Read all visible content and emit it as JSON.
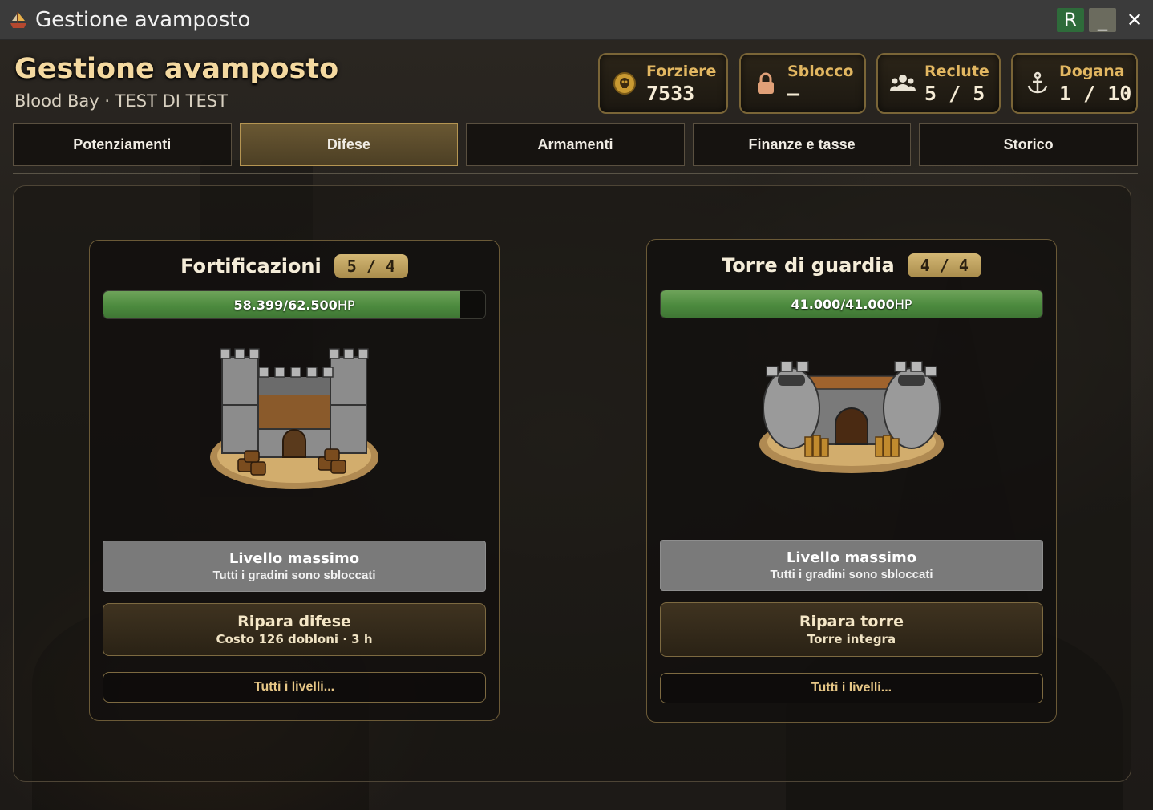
{
  "window": {
    "title": "Gestione avamposto",
    "buttons": {
      "r": "R",
      "minimize": "_",
      "close": "✕"
    }
  },
  "header": {
    "title": "Gestione avamposto",
    "subtitle": "Blood Bay · TEST DI TEST"
  },
  "stats": [
    {
      "label": "Forziere",
      "value": "7533",
      "icon": "skull-coin-icon"
    },
    {
      "label": "Sblocco",
      "value": "—",
      "icon": "lock-icon"
    },
    {
      "label": "Reclute",
      "value": "5 / 5",
      "icon": "users-icon"
    },
    {
      "label": "Dogana",
      "value": "1 / 10",
      "icon": "anchor-icon"
    }
  ],
  "tabs": [
    {
      "label": "Potenziamenti",
      "active": false
    },
    {
      "label": "Difese",
      "active": true
    },
    {
      "label": "Armamenti",
      "active": false
    },
    {
      "label": "Finanze e tasse",
      "active": false
    },
    {
      "label": "Storico",
      "active": false
    }
  ],
  "cards": [
    {
      "title": "Fortificazioni",
      "badge": "5 / 4",
      "hp_text": "58.399/62.500",
      "hp_unit": "HP",
      "hp_current": 58399,
      "hp_max": 62500,
      "image": "fortress-icon",
      "max_title": "Livello massimo",
      "max_sub": "Tutti i gradini sono sbloccati",
      "repair_title": "Ripara difese",
      "repair_sub": "Costo 126 dobloni · 3 h",
      "levels_label": "Tutti i livelli..."
    },
    {
      "title": "Torre di guardia",
      "badge": "4 / 4",
      "hp_text": "41.000/41.000",
      "hp_unit": "HP",
      "hp_current": 41000,
      "hp_max": 41000,
      "image": "watchtower-icon",
      "max_title": "Livello massimo",
      "max_sub": "Tutti i gradini sono sbloccati",
      "repair_title": "Ripara torre",
      "repair_sub": "Torre integra",
      "levels_label": "Tutti i livelli..."
    }
  ],
  "colors": {
    "accent_gold": "#e2b761",
    "title_gold": "#f4d9a0",
    "hp_green": "#4c8a3e",
    "active_tab": "#5a4a2b"
  }
}
